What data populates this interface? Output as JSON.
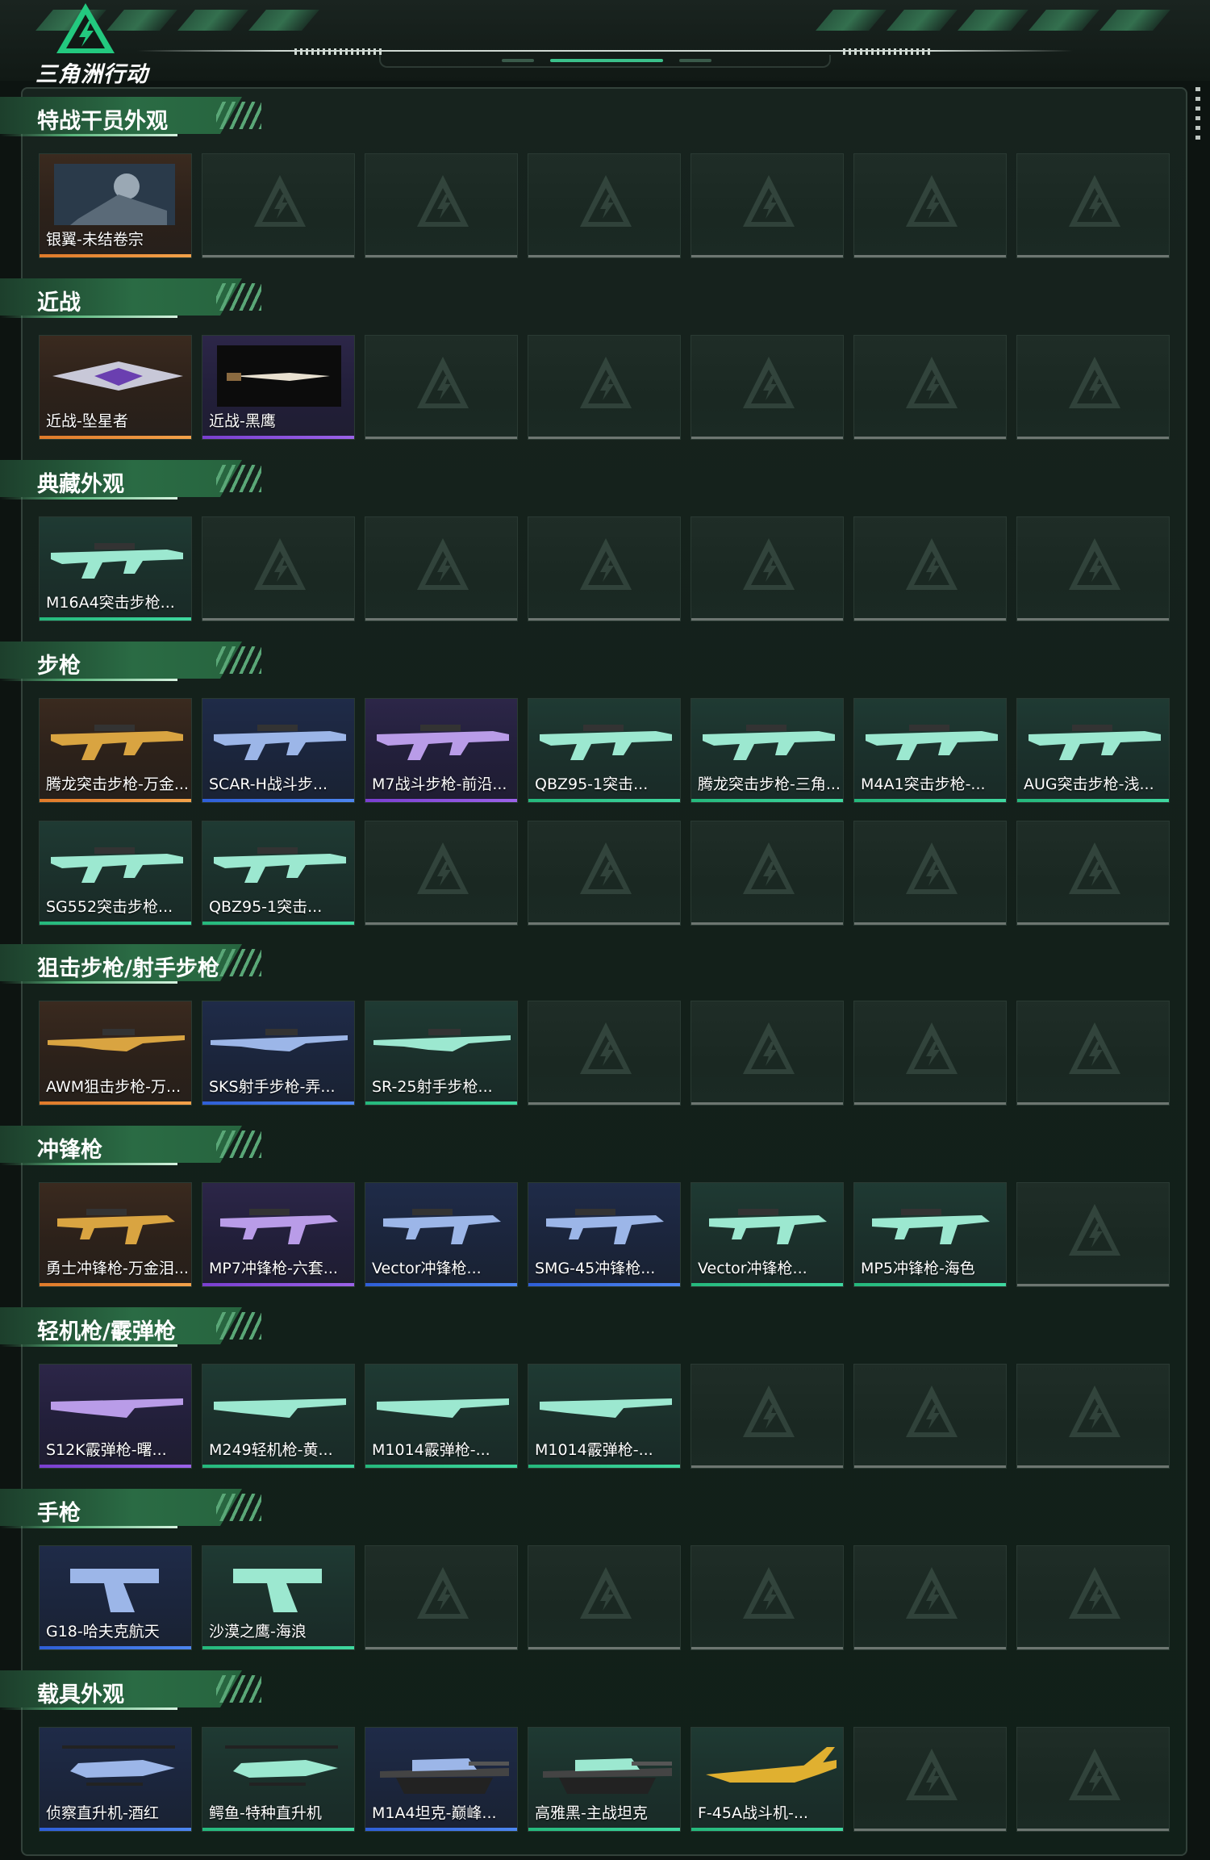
{
  "app": {
    "logo_text": "三角洲行动",
    "colors": {
      "accent": "#3d8a5f",
      "orange": "#e07a2a",
      "purple": "#8a4fd8",
      "blue": "#3a6fe0",
      "green": "#2ec98a"
    }
  },
  "sections": [
    {
      "title": "特战干员外观",
      "rows": [
        [
          {
            "label": "银翼-未结卷宗",
            "rarity": "orange",
            "icon": "operator-portrait-icon"
          }
        ]
      ]
    },
    {
      "title": "近战",
      "rows": [
        [
          {
            "label": "近战-坠星者",
            "rarity": "orange",
            "icon": "melee-blade-icon"
          },
          {
            "label": "近战-黑鹰",
            "rarity": "purple",
            "icon": "knife-icon"
          }
        ]
      ]
    },
    {
      "title": "典藏外观",
      "rows": [
        [
          {
            "label": "M16A4突击步枪...",
            "rarity": "green",
            "icon": "rifle-icon"
          }
        ]
      ]
    },
    {
      "title": "步枪",
      "rows": [
        [
          {
            "label": "腾龙突击步枪-万金...",
            "rarity": "orange",
            "icon": "rifle-icon"
          },
          {
            "label": "SCAR-H战斗步...",
            "rarity": "blue",
            "icon": "rifle-icon"
          },
          {
            "label": "M7战斗步枪-前沿...",
            "rarity": "purple",
            "icon": "rifle-icon"
          },
          {
            "label": "QBZ95-1突击...",
            "rarity": "green",
            "icon": "rifle-icon"
          },
          {
            "label": "腾龙突击步枪-三角...",
            "rarity": "green",
            "icon": "rifle-icon"
          },
          {
            "label": "M4A1突击步枪-...",
            "rarity": "green",
            "icon": "rifle-icon"
          },
          {
            "label": "AUG突击步枪-浅...",
            "rarity": "green",
            "icon": "rifle-icon"
          }
        ],
        [
          {
            "label": "SG552突击步枪...",
            "rarity": "green",
            "icon": "rifle-icon"
          },
          {
            "label": "QBZ95-1突击...",
            "rarity": "green",
            "icon": "rifle-icon"
          }
        ]
      ]
    },
    {
      "title": "狙击步枪/射手步枪",
      "rows": [
        [
          {
            "label": "AWM狙击步枪-万...",
            "rarity": "orange",
            "icon": "sniper-rifle-icon"
          },
          {
            "label": "SKS射手步枪-弄...",
            "rarity": "blue",
            "icon": "sniper-rifle-icon"
          },
          {
            "label": "SR-25射手步枪...",
            "rarity": "green",
            "icon": "sniper-rifle-icon"
          }
        ]
      ]
    },
    {
      "title": "冲锋枪",
      "rows": [
        [
          {
            "label": "勇士冲锋枪-万金泪...",
            "rarity": "orange",
            "icon": "smg-icon"
          },
          {
            "label": "MP7冲锋枪-六套...",
            "rarity": "purple",
            "icon": "smg-icon"
          },
          {
            "label": "Vector冲锋枪...",
            "rarity": "blue",
            "icon": "smg-icon"
          },
          {
            "label": "SMG-45冲锋枪...",
            "rarity": "blue",
            "icon": "smg-icon"
          },
          {
            "label": "Vector冲锋枪...",
            "rarity": "green",
            "icon": "smg-icon"
          },
          {
            "label": "MP5冲锋枪-海色",
            "rarity": "green",
            "icon": "smg-icon"
          }
        ]
      ]
    },
    {
      "title": "轻机枪/霰弹枪",
      "rows": [
        [
          {
            "label": "S12K霰弹枪-曙...",
            "rarity": "purple",
            "icon": "shotgun-icon"
          },
          {
            "label": "M249轻机枪-黄...",
            "rarity": "green",
            "icon": "machine-gun-icon"
          },
          {
            "label": "M1014霰弹枪-...",
            "rarity": "green",
            "icon": "shotgun-icon"
          },
          {
            "label": "M1014霰弹枪-...",
            "rarity": "green",
            "icon": "shotgun-icon"
          }
        ]
      ]
    },
    {
      "title": "手枪",
      "rows": [
        [
          {
            "label": "G18-哈夫克航天",
            "rarity": "blue",
            "icon": "pistol-icon"
          },
          {
            "label": "沙漠之鹰-海浪",
            "rarity": "green",
            "icon": "pistol-icon"
          }
        ]
      ]
    },
    {
      "title": "载具外观",
      "rows": [
        [
          {
            "label": "侦察直升机-酒红",
            "rarity": "blue",
            "icon": "helicopter-icon"
          },
          {
            "label": "鳄鱼-特种直升机",
            "rarity": "green",
            "icon": "helicopter-icon"
          },
          {
            "label": "M1A4坦克-巅峰...",
            "rarity": "blue",
            "icon": "tank-icon"
          },
          {
            "label": "高雅黑-主战坦克",
            "rarity": "green",
            "icon": "tank-icon"
          },
          {
            "label": "F-45A战斗机-...",
            "rarity": "green",
            "icon": "fighter-jet-icon"
          }
        ]
      ]
    }
  ]
}
